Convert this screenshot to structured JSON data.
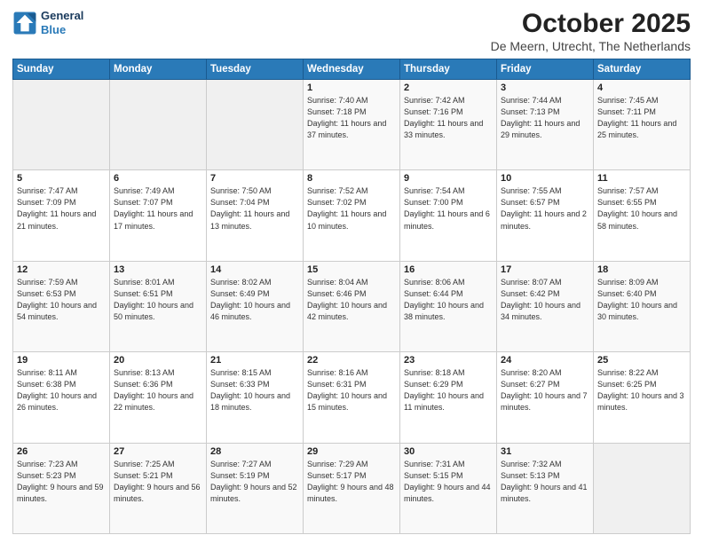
{
  "logo": {
    "line1": "General",
    "line2": "Blue"
  },
  "title": "October 2025",
  "subtitle": "De Meern, Utrecht, The Netherlands",
  "days_of_week": [
    "Sunday",
    "Monday",
    "Tuesday",
    "Wednesday",
    "Thursday",
    "Friday",
    "Saturday"
  ],
  "weeks": [
    [
      {
        "day": "",
        "info": ""
      },
      {
        "day": "",
        "info": ""
      },
      {
        "day": "",
        "info": ""
      },
      {
        "day": "1",
        "info": "Sunrise: 7:40 AM\nSunset: 7:18 PM\nDaylight: 11 hours and 37 minutes."
      },
      {
        "day": "2",
        "info": "Sunrise: 7:42 AM\nSunset: 7:16 PM\nDaylight: 11 hours and 33 minutes."
      },
      {
        "day": "3",
        "info": "Sunrise: 7:44 AM\nSunset: 7:13 PM\nDaylight: 11 hours and 29 minutes."
      },
      {
        "day": "4",
        "info": "Sunrise: 7:45 AM\nSunset: 7:11 PM\nDaylight: 11 hours and 25 minutes."
      }
    ],
    [
      {
        "day": "5",
        "info": "Sunrise: 7:47 AM\nSunset: 7:09 PM\nDaylight: 11 hours and 21 minutes."
      },
      {
        "day": "6",
        "info": "Sunrise: 7:49 AM\nSunset: 7:07 PM\nDaylight: 11 hours and 17 minutes."
      },
      {
        "day": "7",
        "info": "Sunrise: 7:50 AM\nSunset: 7:04 PM\nDaylight: 11 hours and 13 minutes."
      },
      {
        "day": "8",
        "info": "Sunrise: 7:52 AM\nSunset: 7:02 PM\nDaylight: 11 hours and 10 minutes."
      },
      {
        "day": "9",
        "info": "Sunrise: 7:54 AM\nSunset: 7:00 PM\nDaylight: 11 hours and 6 minutes."
      },
      {
        "day": "10",
        "info": "Sunrise: 7:55 AM\nSunset: 6:57 PM\nDaylight: 11 hours and 2 minutes."
      },
      {
        "day": "11",
        "info": "Sunrise: 7:57 AM\nSunset: 6:55 PM\nDaylight: 10 hours and 58 minutes."
      }
    ],
    [
      {
        "day": "12",
        "info": "Sunrise: 7:59 AM\nSunset: 6:53 PM\nDaylight: 10 hours and 54 minutes."
      },
      {
        "day": "13",
        "info": "Sunrise: 8:01 AM\nSunset: 6:51 PM\nDaylight: 10 hours and 50 minutes."
      },
      {
        "day": "14",
        "info": "Sunrise: 8:02 AM\nSunset: 6:49 PM\nDaylight: 10 hours and 46 minutes."
      },
      {
        "day": "15",
        "info": "Sunrise: 8:04 AM\nSunset: 6:46 PM\nDaylight: 10 hours and 42 minutes."
      },
      {
        "day": "16",
        "info": "Sunrise: 8:06 AM\nSunset: 6:44 PM\nDaylight: 10 hours and 38 minutes."
      },
      {
        "day": "17",
        "info": "Sunrise: 8:07 AM\nSunset: 6:42 PM\nDaylight: 10 hours and 34 minutes."
      },
      {
        "day": "18",
        "info": "Sunrise: 8:09 AM\nSunset: 6:40 PM\nDaylight: 10 hours and 30 minutes."
      }
    ],
    [
      {
        "day": "19",
        "info": "Sunrise: 8:11 AM\nSunset: 6:38 PM\nDaylight: 10 hours and 26 minutes."
      },
      {
        "day": "20",
        "info": "Sunrise: 8:13 AM\nSunset: 6:36 PM\nDaylight: 10 hours and 22 minutes."
      },
      {
        "day": "21",
        "info": "Sunrise: 8:15 AM\nSunset: 6:33 PM\nDaylight: 10 hours and 18 minutes."
      },
      {
        "day": "22",
        "info": "Sunrise: 8:16 AM\nSunset: 6:31 PM\nDaylight: 10 hours and 15 minutes."
      },
      {
        "day": "23",
        "info": "Sunrise: 8:18 AM\nSunset: 6:29 PM\nDaylight: 10 hours and 11 minutes."
      },
      {
        "day": "24",
        "info": "Sunrise: 8:20 AM\nSunset: 6:27 PM\nDaylight: 10 hours and 7 minutes."
      },
      {
        "day": "25",
        "info": "Sunrise: 8:22 AM\nSunset: 6:25 PM\nDaylight: 10 hours and 3 minutes."
      }
    ],
    [
      {
        "day": "26",
        "info": "Sunrise: 7:23 AM\nSunset: 5:23 PM\nDaylight: 9 hours and 59 minutes."
      },
      {
        "day": "27",
        "info": "Sunrise: 7:25 AM\nSunset: 5:21 PM\nDaylight: 9 hours and 56 minutes."
      },
      {
        "day": "28",
        "info": "Sunrise: 7:27 AM\nSunset: 5:19 PM\nDaylight: 9 hours and 52 minutes."
      },
      {
        "day": "29",
        "info": "Sunrise: 7:29 AM\nSunset: 5:17 PM\nDaylight: 9 hours and 48 minutes."
      },
      {
        "day": "30",
        "info": "Sunrise: 7:31 AM\nSunset: 5:15 PM\nDaylight: 9 hours and 44 minutes."
      },
      {
        "day": "31",
        "info": "Sunrise: 7:32 AM\nSunset: 5:13 PM\nDaylight: 9 hours and 41 minutes."
      },
      {
        "day": "",
        "info": ""
      }
    ]
  ]
}
